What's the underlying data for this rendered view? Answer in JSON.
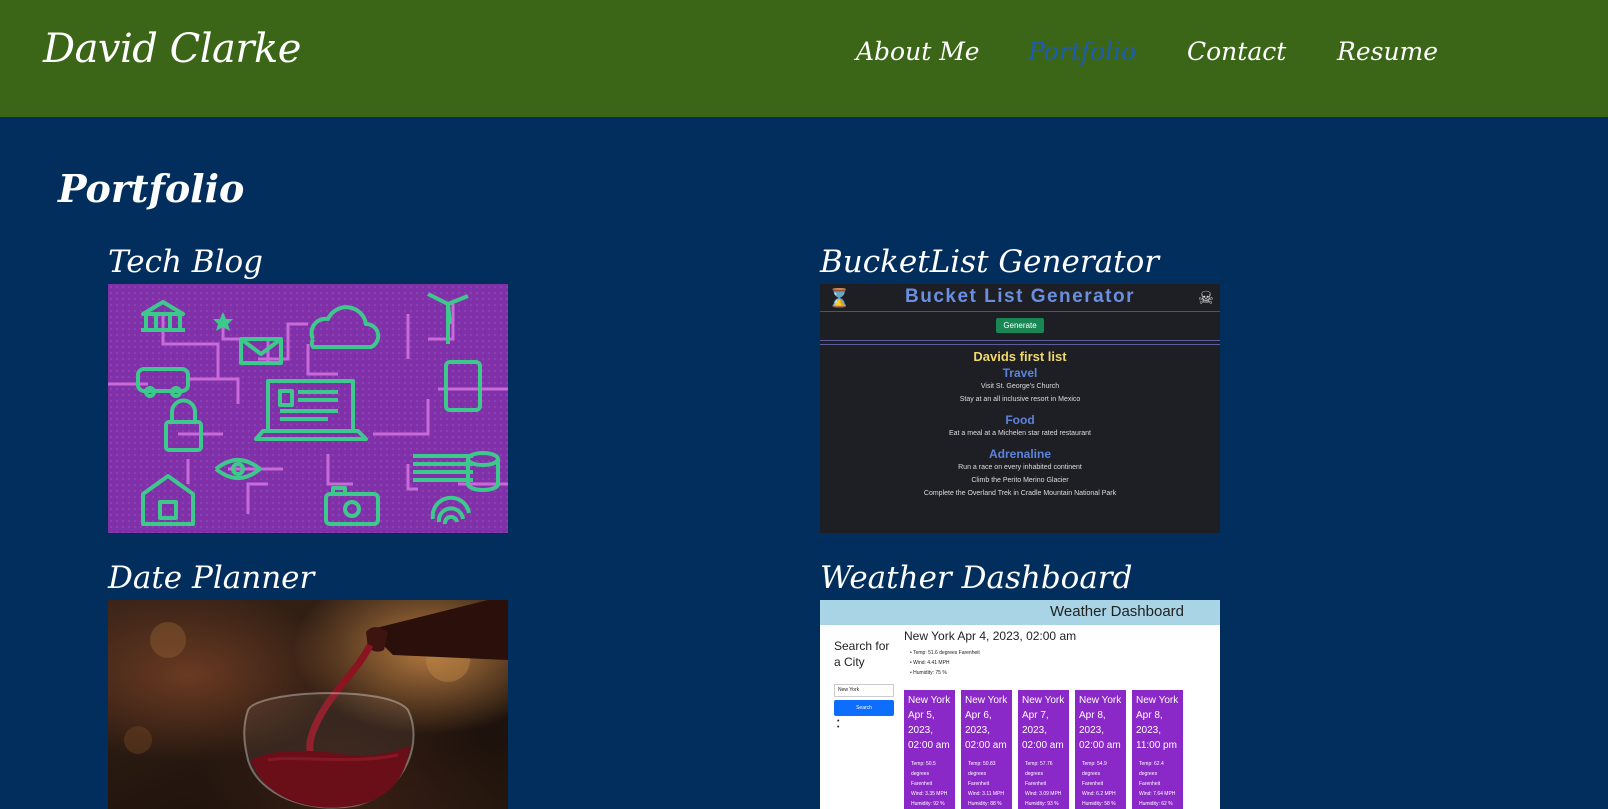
{
  "header": {
    "brand": "David Clarke",
    "nav": [
      {
        "label": "About Me",
        "active": false
      },
      {
        "label": "Portfolio",
        "active": true
      },
      {
        "label": "Contact",
        "active": false
      },
      {
        "label": "Resume",
        "active": false
      }
    ]
  },
  "main": {
    "title": "Portfolio",
    "projects": [
      {
        "title": "Tech Blog",
        "image": "tech-network-illustration"
      },
      {
        "title": "BucketList Generator",
        "image": "bucketlist-app-screenshot"
      },
      {
        "title": "Date Planner",
        "image": "wine-pour-photo"
      },
      {
        "title": "Weather Dashboard",
        "image": "weather-app-screenshot"
      }
    ]
  },
  "bucketlist_preview": {
    "app_title": "Bucket List Generator",
    "button": "Generate",
    "list_title": "Davids first list",
    "categories": [
      {
        "name": "Travel",
        "items": [
          "Visit St. George's Church",
          "Stay at an all inclusive resort in Mexico"
        ]
      },
      {
        "name": "Food",
        "items": [
          "Eat a meal at a Michelen star rated restaurant"
        ]
      },
      {
        "name": "Adrenaline",
        "items": [
          "Run a race on every inhabited continent",
          "Climb the Perito Merino Glacier",
          "Complete the Overland Trek in Cradle Mountain National Park"
        ]
      }
    ]
  },
  "weather_preview": {
    "app_title": "Weather Dashboard",
    "search_label": "Search for a City",
    "search_value": "New York",
    "search_button": "Search",
    "current": {
      "heading": "New York Apr 4, 2023, 02:00 am",
      "temp": "Temp: 51.6 degrees Farenheit",
      "wind": "Wind: 4.41 MPH",
      "humidity": "Humidity: 75 %"
    },
    "forecast": [
      {
        "city": "New York",
        "date": "Apr 5, 2023,",
        "time": "02:00 am",
        "temp": "Temp: 50.5 degrees Farenheit",
        "wind": "Wind: 3.35 MPH",
        "humidity": "Humidity: 92 %"
      },
      {
        "city": "New York",
        "date": "Apr 6, 2023,",
        "time": "02:00 am",
        "temp": "Temp: 50.83 degrees Farenheit",
        "wind": "Wind: 3.11 MPH",
        "humidity": "Humidity: 88 %"
      },
      {
        "city": "New York",
        "date": "Apr 7, 2023,",
        "time": "02:00 am",
        "temp": "Temp: 57.76 degrees Farenheit",
        "wind": "Wind: 3.09 MPH",
        "humidity": "Humidity: 93 %"
      },
      {
        "city": "New York",
        "date": "Apr 8, 2023,",
        "time": "02:00 am",
        "temp": "Temp: 54.9 degrees Farenheit",
        "wind": "Wind: 6.2 MPH",
        "humidity": "Humidity: 58 %"
      },
      {
        "city": "New York",
        "date": "Apr 8, 2023,",
        "time": "11:00 pm",
        "temp": "Temp: 62.4 degrees Farenheit",
        "wind": "Wind: 7.64 MPH",
        "humidity": "Humidity: 62 %"
      }
    ]
  },
  "colors": {
    "header_bg": "#3b6618",
    "page_bg": "#012e5c",
    "nav_active": "#1d5bb4"
  }
}
